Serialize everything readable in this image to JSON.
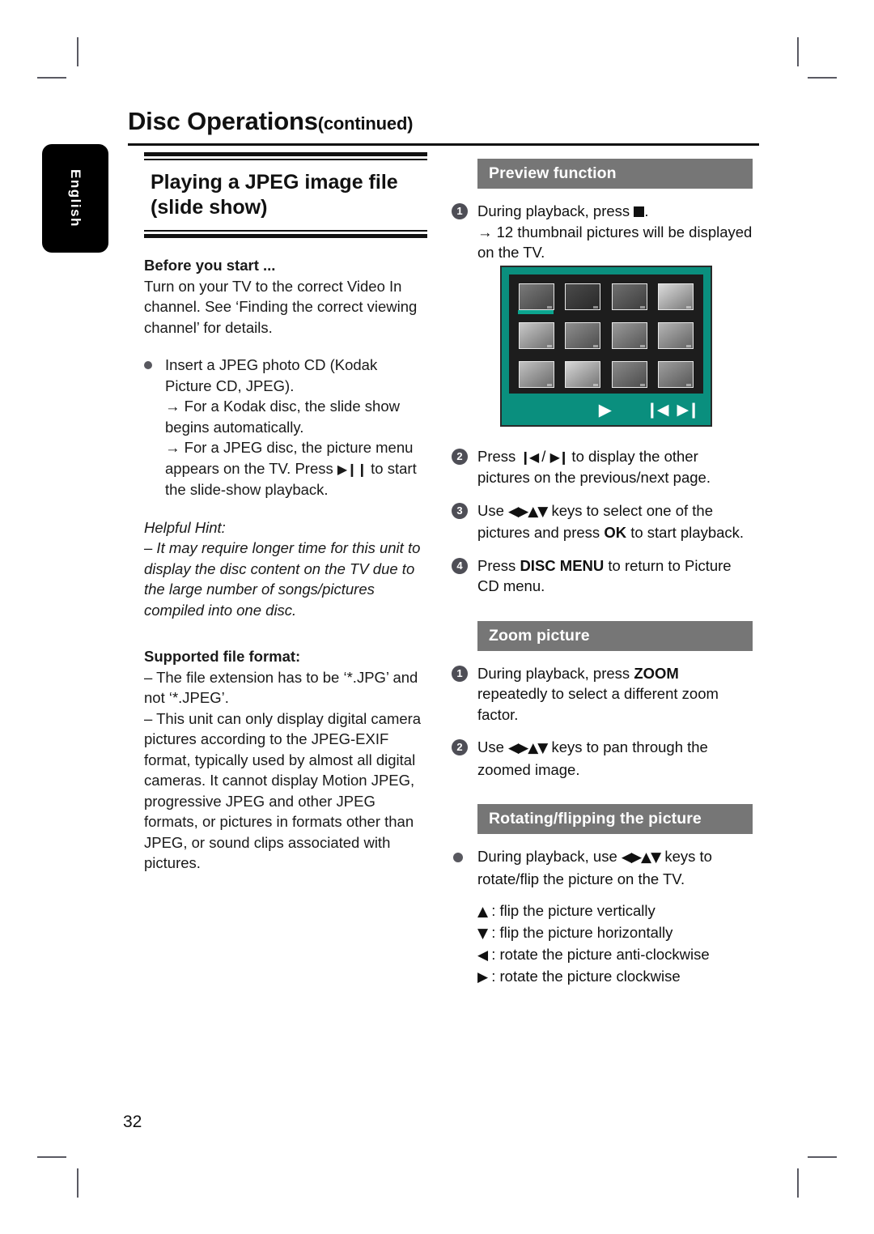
{
  "page": {
    "number": "32",
    "language_tab": "English",
    "title_main": "Disc Operations",
    "title_suffix": "(continued)"
  },
  "left_column": {
    "section_title_line1": "Playing a JPEG image file",
    "section_title_line2": "(slide show)",
    "before_you_start_heading": "Before you start ...",
    "before_you_start_text": "Turn on your TV to the correct Video In channel. See ‘Finding the correct viewing channel’ for details.",
    "insert_bullet": "Insert a JPEG photo CD (Kodak Picture CD, JPEG).",
    "insert_arrow_1": "→ For a Kodak disc, the slide show begins automatically.",
    "insert_arrow_2_pre": "→ For a JPEG disc, the picture menu appears on the TV. Press ",
    "insert_arrow_2_glyph": "▶❙❙",
    "insert_arrow_2_post": " to start the slide-show playback.",
    "helpful_hint_heading": "Helpful Hint:",
    "helpful_hint_text": "– It may require longer time for this unit to display the disc content on the TV due to the large number of songs/pictures compiled into one disc.",
    "supported_heading": "Supported file format:",
    "supported_item_1": "– The file extension has to be ‘*.JPG’ and not ‘*.JPEG’.",
    "supported_item_2": "– This unit can only display digital camera pictures according to the JPEG-EXIF format, typically used by almost all digital cameras. It cannot display Motion JPEG, progressive JPEG and other JPEG formats, or pictures in formats other than JPEG, or sound clips associated with pictures."
  },
  "right_column": {
    "preview": {
      "bar_label": "Preview function",
      "step1_pre": "During playback, press ",
      "step1_glyph": "stop-square",
      "step1_post": ".",
      "step1_arrow": "→ 12 thumbnail pictures will be displayed on the TV.",
      "step2_pre": "Press ",
      "step2_prev_glyph": "❙◀",
      "step2_sep": " / ",
      "step2_next_glyph": "▶❙",
      "step2_post": " to display the other pictures on the previous/next page.",
      "step3_pre": "Use ",
      "step3_dpad": "◀▶▲▼",
      "step3_mid": " keys to select one of the pictures and press ",
      "step3_key": "OK",
      "step3_post": " to start playback.",
      "step4_pre": "Press ",
      "step4_key": "DISC MENU",
      "step4_post": " to return to Picture CD menu."
    },
    "zoom": {
      "bar_label": "Zoom picture",
      "step1_pre": "During playback, press ",
      "step1_key": "ZOOM",
      "step1_post": " repeatedly to select a different zoom factor.",
      "step2_pre": "Use ",
      "step2_dpad": "◀▶▲▼",
      "step2_post": " keys to pan through the zoomed image."
    },
    "rotating": {
      "bar_label": "Rotating/flipping the picture",
      "bullet_pre": "During playback, use ",
      "bullet_dpad": "◀▶▲▼",
      "bullet_post": " keys to rotate/flip the picture on the TV.",
      "keys": [
        {
          "glyph": "▲",
          "desc": ": flip the picture vertically"
        },
        {
          "glyph": "▼",
          "desc": ": flip the picture horizontally"
        },
        {
          "glyph": "◀",
          "desc": ": rotate the picture anti-clockwise"
        },
        {
          "glyph": "▶",
          "desc": ": rotate the picture clockwise"
        }
      ]
    }
  },
  "tv_figure": {
    "border_color": "#0a8f7e",
    "screen_color": "#1d1d1d",
    "highlight_color": "#0ca58f",
    "selected_index": 0,
    "thumbnails": [
      {
        "shade": "#7a7a7a",
        "desc": "leaf-closeup"
      },
      {
        "shade": "#4b4b4b",
        "desc": "rock-formation"
      },
      {
        "shade": "#6f6f6f",
        "desc": "sunset-water"
      },
      {
        "shade": "#dcdcdc",
        "desc": "flowers-white"
      },
      {
        "shade": "#c9c9c9",
        "desc": "portrait-child"
      },
      {
        "shade": "#8e8e8e",
        "desc": "landscape-field"
      },
      {
        "shade": "#9a9a9a",
        "desc": "hillside-trees"
      },
      {
        "shade": "#b5b5b5",
        "desc": "building-facade"
      },
      {
        "shade": "#c2c2c2",
        "desc": "pebbles-texture"
      },
      {
        "shade": "#d7d7d7",
        "desc": "beach-fog"
      },
      {
        "shade": "#8a8a8a",
        "desc": "crowd-field"
      },
      {
        "shade": "#9f9f9f",
        "desc": "person-arms-up"
      }
    ],
    "controls": {
      "play": "▶",
      "prev": "❙◀",
      "next": "▶❙"
    }
  }
}
